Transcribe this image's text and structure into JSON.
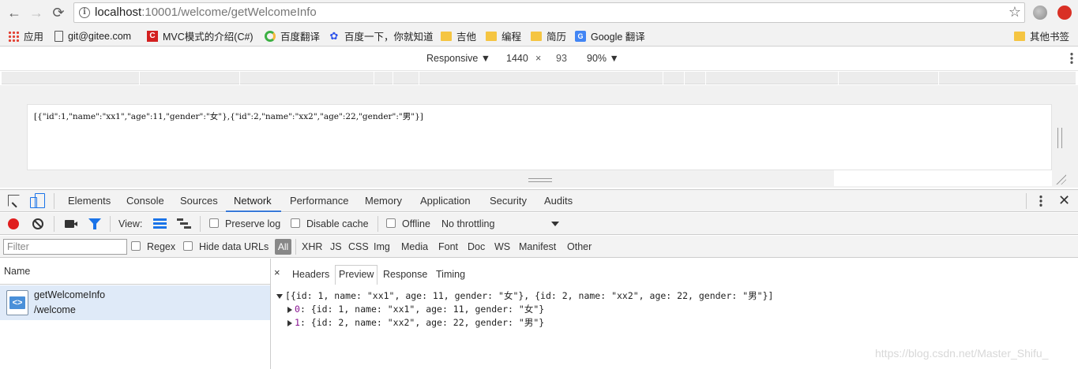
{
  "browser": {
    "url_host": "localhost",
    "url_path": ":10001/welcome/getWelcomeInfo",
    "back_glyph": "←",
    "forward_glyph": "→",
    "reload_glyph": "⟳",
    "star_glyph": "☆"
  },
  "bookmarks": [
    {
      "label": "应用",
      "icon": "apps-icon"
    },
    {
      "label": "git@gitee.com",
      "icon": "page-icon"
    },
    {
      "label": "MVC模式的介绍(C#)",
      "icon": "csdn-icon"
    },
    {
      "label": "百度翻译",
      "icon": "baidu-translate-icon"
    },
    {
      "label": "百度一下，你就知道",
      "icon": "baidu-paw-icon"
    },
    {
      "label": "吉他",
      "icon": "folder-icon"
    },
    {
      "label": "编程",
      "icon": "folder-icon"
    },
    {
      "label": "简历",
      "icon": "folder-icon"
    },
    {
      "label": "Google 翻译",
      "icon": "google-translate-icon"
    },
    {
      "label": "其他书签",
      "icon": "folder-icon"
    }
  ],
  "device_toolbar": {
    "mode": "Responsive ▼",
    "width": "1440",
    "times": "×",
    "height": "93",
    "zoom": "90% ▼"
  },
  "page_body": "[{\"id\":1,\"name\":\"xx1\",\"age\":11,\"gender\":\"女\"},{\"id\":2,\"name\":\"xx2\",\"age\":22,\"gender\":\"男\"}]",
  "devtools": {
    "tabs": [
      "Elements",
      "Console",
      "Sources",
      "Network",
      "Performance",
      "Memory",
      "Application",
      "Security",
      "Audits"
    ],
    "active_tab": "Network",
    "close_glyph": "✕"
  },
  "network_bar": {
    "view_label": "View:",
    "preserve_log": "Preserve log",
    "disable_cache": "Disable cache",
    "offline": "Offline",
    "throttling": "No throttling"
  },
  "filter_bar": {
    "placeholder": "Filter",
    "regex": "Regex",
    "hide_data_urls": "Hide data URLs",
    "all": "All",
    "types": [
      "XHR",
      "JS",
      "CSS",
      "Img",
      "Media",
      "Font",
      "Doc",
      "WS",
      "Manifest",
      "Other"
    ]
  },
  "requests": {
    "column_header": "Name",
    "items": [
      {
        "name": "getWelcomeInfo",
        "path": "/welcome"
      }
    ]
  },
  "detail": {
    "close_glyph": "×",
    "tabs": [
      "Headers",
      "Preview",
      "Response",
      "Timing"
    ],
    "active_tab": "Preview",
    "preview": {
      "root": "[{id: 1, name: \"xx1\", age: 11, gender: \"女\"}, {id: 2, name: \"xx2\", age: 22, gender: \"男\"}]",
      "items": [
        {
          "key": "0",
          "value": "{id: 1, name: \"xx1\", age: 11, gender: \"女\"}"
        },
        {
          "key": "1",
          "value": "{id: 2, name: \"xx2\", age: 22, gender: \"男\"}"
        }
      ]
    }
  },
  "watermark": "https://blog.csdn.net/Master_Shifu_"
}
